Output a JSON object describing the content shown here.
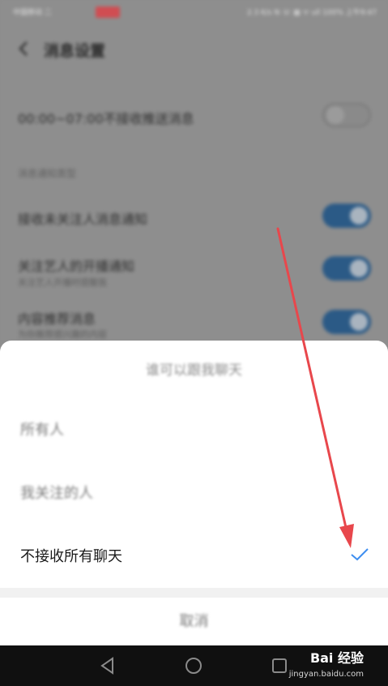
{
  "status_bar": {
    "left_text": "中国移动 二",
    "right_text": "2.3 K/s  N  ☏  ▦  ᯤ  ull  100%  上午9:47"
  },
  "header": {
    "title": "消息设置"
  },
  "settings": {
    "quiet_hours": {
      "label": "00:00~07:00不接收推送消息",
      "enabled": false
    },
    "section_label": "消息通知类型",
    "rows": [
      {
        "label": "接收未关注人消息通知",
        "sub": "",
        "enabled": true
      },
      {
        "label": "关注艺人的开播通知",
        "sub": "关注艺人开播时提醒我",
        "enabled": true
      },
      {
        "label": "内容推荐消息",
        "sub": "为你推荐感兴趣的内容",
        "enabled": true
      }
    ]
  },
  "sheet": {
    "title": "谁可以跟我聊天",
    "options": [
      {
        "label": "所有人",
        "selected": false
      },
      {
        "label": "我关注的人",
        "selected": false
      },
      {
        "label": "不接收所有聊天",
        "selected": true
      }
    ],
    "cancel_label": "取消"
  },
  "watermark": {
    "brand": "Bai 经验",
    "site": "jingyan.baidu.com"
  },
  "colors": {
    "accent_check": "#3d8ef0",
    "toggle_on": "#2b5a86",
    "arrow": "#e8474c"
  }
}
